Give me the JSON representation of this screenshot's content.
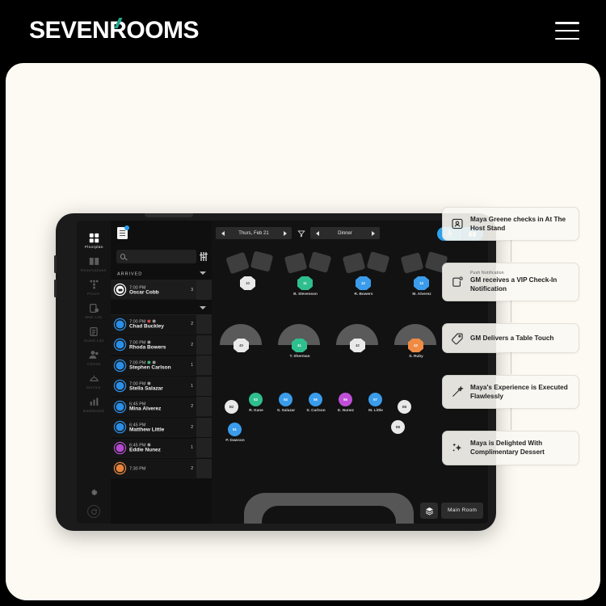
{
  "header": {
    "logo_text": "SEVENROOMS",
    "menu_icon": "hamburger-icon"
  },
  "app": {
    "sidebar": [
      {
        "label": "Floorplan",
        "icon": "grid-icon",
        "active": true
      },
      {
        "label": "Reservations",
        "icon": "book-icon",
        "active": false
      },
      {
        "label": "Floors",
        "icon": "hierarchy-icon",
        "active": false
      },
      {
        "label": "Wait List",
        "icon": "clipboard-clock-icon",
        "active": false
      },
      {
        "label": "Guest List",
        "icon": "list-icon",
        "active": false
      },
      {
        "label": "Clients",
        "icon": "people-icon",
        "active": false
      },
      {
        "label": "Service",
        "icon": "cloche-icon",
        "active": false
      },
      {
        "label": "Dashboard",
        "icon": "bar-chart-icon",
        "active": false
      }
    ],
    "sidebar_footer": [
      {
        "icon": "gear-icon",
        "label": "Settings"
      },
      {
        "icon": "refresh-icon",
        "label": "Refresh"
      }
    ],
    "search": {
      "value": "",
      "placeholder": "",
      "icon": "search-icon"
    },
    "filter_icon": "sliders-icon",
    "list_section": {
      "title": "ARRIVED",
      "collapse_icon": "chevron-down-icon"
    },
    "toolbar": {
      "date": "Thurs, Feb 21",
      "meal": "Dinner",
      "prev_icon": "arrow-left-icon",
      "next_icon": "arrow-right-icon",
      "filter_icon": "funnel-icon",
      "doc_icon": "notes-icon",
      "toggle_left_icon": "walking-person-icon",
      "toggle_right_icon": "gift-card-icon",
      "toggle_color": "#1f8ae0"
    },
    "reservations": [
      {
        "time": "7:00 PM",
        "name": "Oscar Cobb",
        "size": "3",
        "avatar": "white",
        "tags": [],
        "group": "arrived"
      },
      {
        "time": "7:00 PM",
        "name": "Chad Buckley",
        "size": "2",
        "avatar": "blue",
        "tags": [
          "red",
          "grey"
        ],
        "group": "upcoming"
      },
      {
        "time": "7:00 PM",
        "name": "Rhoda Bowers",
        "size": "2",
        "avatar": "blue",
        "tags": [
          "grey"
        ],
        "group": "upcoming"
      },
      {
        "time": "7:00 PM",
        "name": "Stephen Carlson",
        "size": "1",
        "avatar": "blue",
        "tags": [
          "green",
          "grey"
        ],
        "group": "upcoming"
      },
      {
        "time": "7:00 PM",
        "name": "Stella Salazar",
        "size": "1",
        "avatar": "blue",
        "tags": [
          "grey"
        ],
        "group": "upcoming"
      },
      {
        "time": "6:45 PM",
        "name": "Mina Alverez",
        "size": "2",
        "avatar": "blue",
        "tags": [],
        "group": "upcoming"
      },
      {
        "time": "6:45 PM",
        "name": "Matthew Little",
        "size": "2",
        "avatar": "blue",
        "tags": [],
        "group": "upcoming"
      },
      {
        "time": "6:45 PM",
        "name": "Eddie Nunez",
        "size": "1",
        "avatar": "purple",
        "tags": [
          "grey"
        ],
        "group": "upcoming"
      },
      {
        "time": "7:30 PM",
        "name": "",
        "size": "2",
        "avatar": "orange",
        "tags": [],
        "group": "upcoming"
      }
    ],
    "floorplan": {
      "room_label": "Main Room",
      "layers_icon": "layers-icon",
      "tables_row1": [
        {
          "number": "10",
          "name": "",
          "color": "white"
        },
        {
          "number": "11",
          "name": "B. Stevenson",
          "color": "green"
        },
        {
          "number": "12",
          "name": "R. Bowers",
          "color": "blue"
        },
        {
          "number": "13",
          "name": "M. Alverez",
          "color": "blue"
        }
      ],
      "tables_row2": [
        {
          "number": "40",
          "name": "",
          "color": "white"
        },
        {
          "number": "41",
          "name": "T. Sherman",
          "color": "green"
        },
        {
          "number": "42",
          "name": "",
          "color": "white"
        },
        {
          "number": "43",
          "name": "S. Ruby",
          "color": "orange"
        }
      ],
      "tables_row3": [
        {
          "number": "B2",
          "name": "",
          "color": "white"
        },
        {
          "number": "53",
          "name": "R. Kane",
          "color": "green"
        },
        {
          "number": "54",
          "name": "S. Salazar",
          "color": "blue"
        },
        {
          "number": "55",
          "name": "S. Carlson",
          "color": "blue"
        },
        {
          "number": "56",
          "name": "E. Nunez",
          "color": "purple"
        },
        {
          "number": "57",
          "name": "M. Little",
          "color": "blue"
        },
        {
          "number": "B8",
          "name": "",
          "color": "white"
        }
      ],
      "tables_row4": [
        {
          "number": "51",
          "name": "P. Dawson",
          "color": "blue"
        },
        {
          "number": "B8",
          "name": "",
          "color": "white"
        }
      ]
    }
  },
  "notifications": [
    {
      "kicker": "",
      "text": "Maya Greene checks in At The Host Stand",
      "icon": "person-card-icon"
    },
    {
      "kicker": "Push Notification",
      "text": "GM receives a VIP Check-In Notification",
      "icon": "phone-notification-icon"
    },
    {
      "kicker": "",
      "text": "GM Delivers a Table Touch",
      "icon": "tag-icon"
    },
    {
      "kicker": "",
      "text": "Maya's Experience is Executed Flawlessly",
      "icon": "magic-wand-icon"
    },
    {
      "kicker": "",
      "text": "Maya is Delighted With Complimentary Dessert",
      "icon": "sparkles-icon"
    }
  ],
  "colors": {
    "brand_teal": "#23a890",
    "accent_blue": "#1f8ae0",
    "page_bg": "#FDFAF3",
    "header_bg": "#000000"
  }
}
